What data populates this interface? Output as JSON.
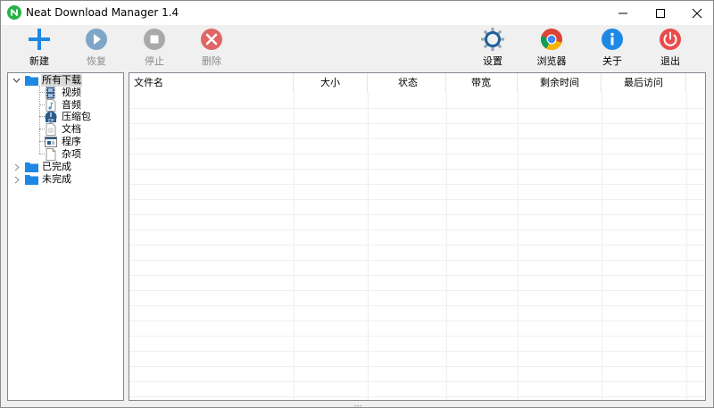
{
  "window": {
    "title": "Neat Download Manager 1.4"
  },
  "toolbar": {
    "new": "新建",
    "resume": "恢复",
    "stop": "停止",
    "delete": "删除",
    "settings": "设置",
    "browser": "浏览器",
    "about": "关于",
    "exit": "退出"
  },
  "tree": {
    "root": "所有下载",
    "children": [
      "视频",
      "音频",
      "压缩包",
      "文档",
      "程序",
      "杂项"
    ],
    "completed": "已完成",
    "incomplete": "未完成"
  },
  "list": {
    "columns": [
      "文件名",
      "大小",
      "状态",
      "带宽",
      "剩余时间",
      "最后访问"
    ]
  },
  "colors": {
    "accent_blue": "#1e88e5",
    "disabled_gray": "#8d8d8d",
    "delete_red": "#e06666",
    "exit_red": "#e84c4c",
    "about_blue": "#1e88e5",
    "app_green": "#27b24a"
  }
}
